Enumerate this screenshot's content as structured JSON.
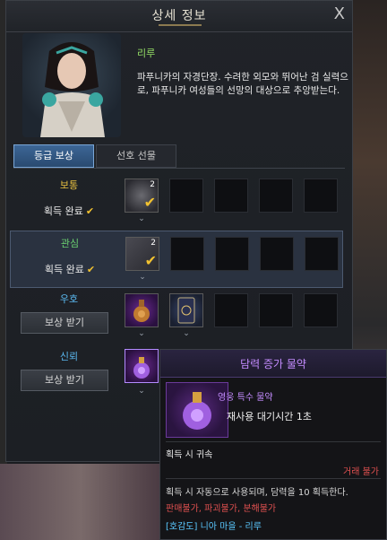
{
  "window": {
    "title": "상세 정보",
    "close_icon": "X"
  },
  "character": {
    "name": "리루",
    "description": "파푸니카의 자경단장. 수려한 외모와 뛰어난 검 실력으로, 파푸니카 여성들의 선망의 대상으로 추앙받는다."
  },
  "tabs": [
    {
      "label": "등급 보상",
      "active": true
    },
    {
      "label": "선호 선물",
      "active": false
    }
  ],
  "rewards": [
    {
      "grade": "보통",
      "grade_color": "#e8c040",
      "state": "획득 완료",
      "slots": [
        {
          "icon": "coin-medal-icon",
          "count": "2",
          "claimed": true
        }
      ]
    },
    {
      "grade": "관심",
      "grade_color": "#6ad070",
      "state": "획득 완료",
      "slots": [
        {
          "icon": "card-pack-icon",
          "count": "2",
          "claimed": true
        }
      ]
    },
    {
      "grade": "우호",
      "grade_color": "#5ab8f0",
      "button": "보상 받기",
      "slots": [
        {
          "icon": "bomb-flask-icon"
        },
        {
          "icon": "tarot-card-icon"
        }
      ]
    },
    {
      "grade": "신뢰",
      "grade_color": "#5ab8f0",
      "button": "보상 받기",
      "slots": [
        {
          "icon": "purple-potion-icon"
        }
      ]
    }
  ],
  "tooltip": {
    "title": "담력 증가 물약",
    "subtitle": "영웅 특수 물약",
    "cooldown": "재사용 대기시간 1초",
    "bind": "획득 시 귀속",
    "trade": "거래 불가",
    "effect": "획득 시 자동으로 사용되며, 담력을 10 획득한다.",
    "restrictions": "판매불가, 파괴불가, 분해불가",
    "source": "[호감도] 니아 마을 - 리루"
  },
  "colors": {
    "accent_blue": "#3c6696",
    "check_yellow": "#f2c230",
    "tooltip_purple": "#c48cff",
    "warning_red": "#e05050"
  }
}
